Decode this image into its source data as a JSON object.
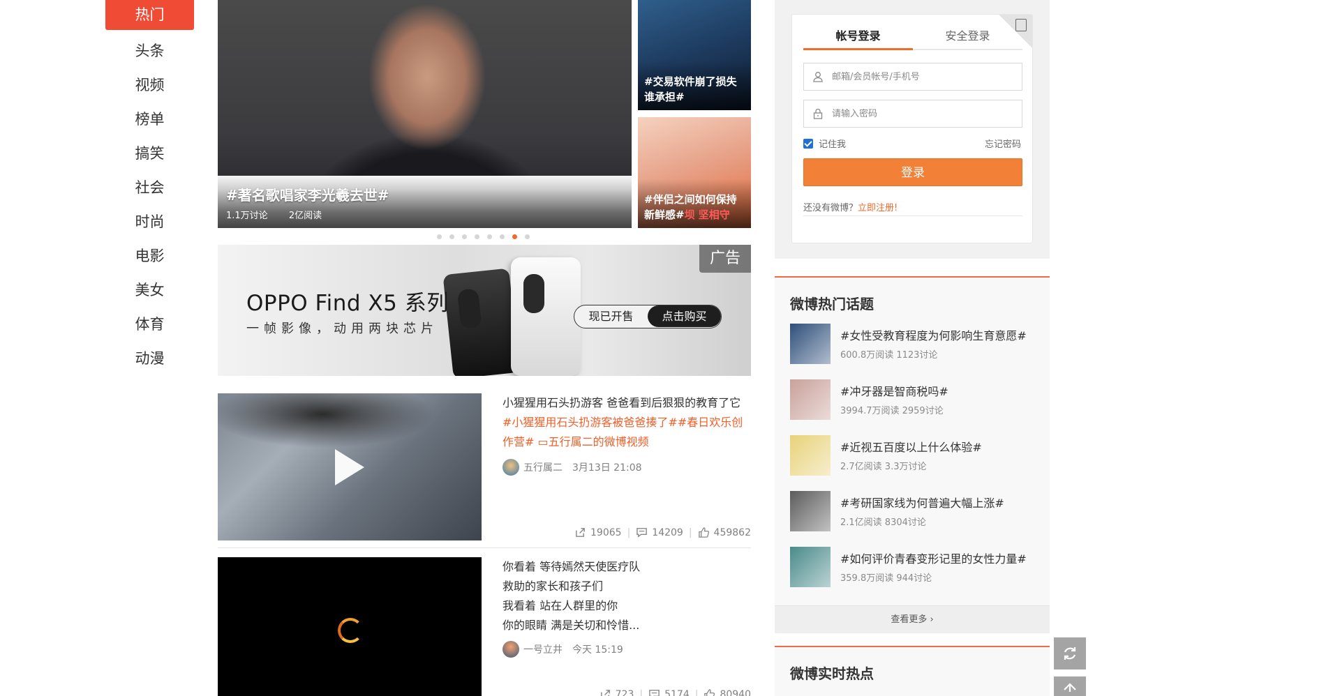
{
  "nav": {
    "items": [
      {
        "label": "热门",
        "active": true
      },
      {
        "label": "头条"
      },
      {
        "label": "视频"
      },
      {
        "label": "榜单"
      },
      {
        "label": "搞笑"
      },
      {
        "label": "社会"
      },
      {
        "label": "时尚"
      },
      {
        "label": "电影"
      },
      {
        "label": "美女"
      },
      {
        "label": "体育"
      },
      {
        "label": "动漫"
      }
    ]
  },
  "carousel": {
    "main": {
      "title": "#著名歌唱家李光羲去世#",
      "discussions": "1.1万讨论",
      "reads": "2亿阅读"
    },
    "side": [
      {
        "caption": "#交易软件崩了损失谁承担#"
      },
      {
        "caption_a": "#伴侣之间如何保持新鲜感#",
        "caption_b": "坝 坚相守"
      }
    ],
    "dot_count": 8,
    "active_dot": 6
  },
  "ad": {
    "title": "OPPO Find X5 系列",
    "subtitle": "一帧影像，动用两块芯片",
    "pill_left": "现已开售",
    "pill_right": "点击购买",
    "badge": "广告"
  },
  "feed": [
    {
      "text_plain": "小猩猩用石头扔游客 爸爸看到后狠狠的教育了它",
      "text_tags": "#小猩猩用石头扔游客被爸爸揍了##春日欢乐创作营# ▭五行属二的微博视频",
      "author": "五行属二",
      "time": "3月13日 21:08",
      "reposts": "19065",
      "comments": "14209",
      "likes": "459862"
    },
    {
      "lines": [
        "你看着 等待嫣然天使医疗队",
        "救助的家长和孩子们",
        "我看着 站在人群里的你",
        "你的眼睛 满是关切和怜惜..."
      ],
      "author": "一号立井",
      "time": "今天 15:19",
      "reposts": "723",
      "comments": "5174",
      "likes": "80940"
    }
  ],
  "login": {
    "tab_account": "帐号登录",
    "tab_secure": "安全登录",
    "username_placeholder": "邮箱/会员帐号/手机号",
    "password_placeholder": "请输入密码",
    "remember": "记住我",
    "forgot": "忘记密码",
    "submit": "登录",
    "register_prompt": "还没有微博？",
    "register_link": "立即注册!"
  },
  "hot_topics": {
    "title": "微博热门话题",
    "items": [
      {
        "title": "#女性受教育程度为何影响生育意愿#",
        "meta": "600.8万阅读 1123讨论",
        "color": "#2f4f7a"
      },
      {
        "title": "#冲牙器是智商税吗#",
        "meta": "3994.7万阅读 2959讨论",
        "color": "#c9a19a"
      },
      {
        "title": "#近视五百度以上什么体验#",
        "meta": "2.7亿阅读 3.3万讨论",
        "color": "#e8d27a"
      },
      {
        "title": "#考研国家线为何普遍大幅上涨#",
        "meta": "2.1亿阅读 8304讨论",
        "color": "#5c5c5c"
      },
      {
        "title": "#如何评价青春变形记里的女性力量#",
        "meta": "359.8万阅读 944讨论",
        "color": "#4a8a8a"
      }
    ],
    "more": "查看更多 ›"
  },
  "realtime": {
    "title": "微博实时热点"
  }
}
